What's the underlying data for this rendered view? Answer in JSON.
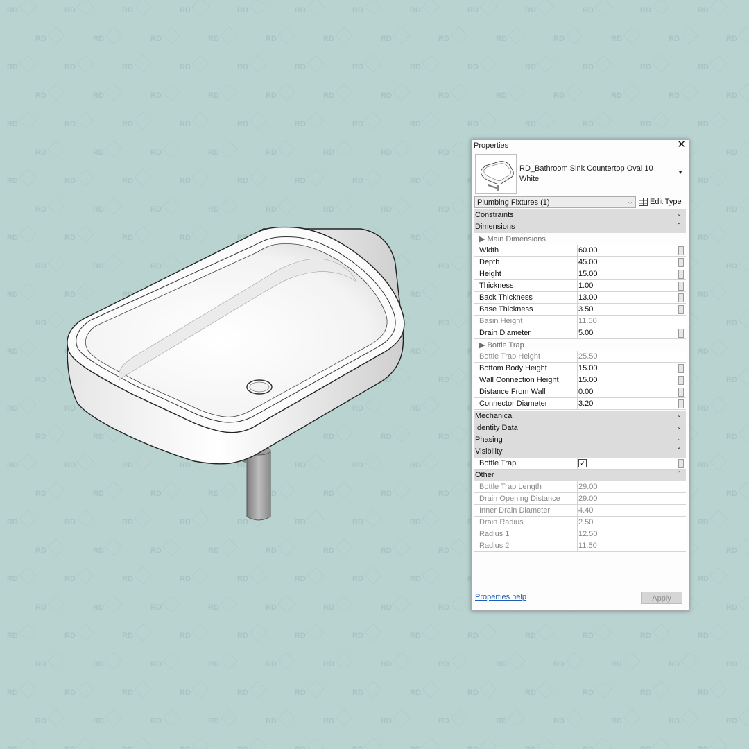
{
  "watermark_text": "RD",
  "colors": {
    "background": "#b9d3d1",
    "category_band": "#dcdcdc",
    "link": "#1a5fb4"
  },
  "properties_panel": {
    "title": "Properties",
    "type_name": "RD_Bathroom Sink Countertop Oval 10 White",
    "filter": "Plumbing Fixtures (1)",
    "edit_type": "Edit Type",
    "categories": {
      "constraints": "Constraints",
      "dimensions": "Dimensions",
      "mechanical": "Mechanical",
      "identity": "Identity Data",
      "phasing": "Phasing",
      "visibility": "Visibility",
      "other": "Other"
    },
    "subheads": {
      "main": "Main Dimensions",
      "bottle_trap": "Bottle Trap"
    },
    "dimensions": [
      {
        "name": "Width",
        "value": "60.00"
      },
      {
        "name": "Depth",
        "value": "45.00"
      },
      {
        "name": "Height",
        "value": "15.00"
      },
      {
        "name": "Thickness",
        "value": "1.00"
      },
      {
        "name": "Back Thickness",
        "value": "13.00"
      },
      {
        "name": "Base Thickness",
        "value": "3.50"
      },
      {
        "name": "Basin Height",
        "value": "11.50"
      },
      {
        "name": "Drain Diameter",
        "value": "5.00"
      }
    ],
    "bottle_trap": [
      {
        "name": "Bottle Trap Height",
        "value": "25.50"
      },
      {
        "name": "Bottom Body Height",
        "value": "15.00"
      },
      {
        "name": "Wall Connection Height",
        "value": "15.00"
      },
      {
        "name": "Distance From Wall",
        "value": "0.00"
      },
      {
        "name": "Connector Diameter",
        "value": "3.20"
      }
    ],
    "visibility": [
      {
        "name": "Bottle Trap",
        "checked": true
      }
    ],
    "other": [
      {
        "name": "Bottle Trap Length",
        "value": "29.00"
      },
      {
        "name": "Drain Opening Distance",
        "value": "29.00"
      },
      {
        "name": "Inner Drain Diameter",
        "value": "4.40"
      },
      {
        "name": "Drain Radius",
        "value": "2.50"
      },
      {
        "name": "Radius 1",
        "value": "12.50"
      },
      {
        "name": "Radius 2",
        "value": "11.50"
      }
    ],
    "help_link": "Properties help",
    "apply": "Apply"
  }
}
